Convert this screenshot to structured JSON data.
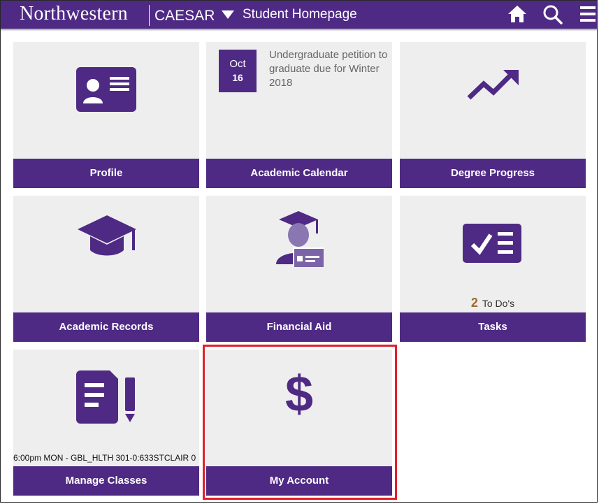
{
  "header": {
    "brand": "Northwestern",
    "app": "CAESAR",
    "page_title": "Student Homepage"
  },
  "icons": {
    "home": "home-icon",
    "search": "search-icon",
    "menu": "hamburger-menu-icon"
  },
  "colors": {
    "accent": "#4e2a84",
    "tile_bg": "#eeeeee",
    "highlight": "#e0202a",
    "todo_count": "#9c6b2e"
  },
  "tiles": [
    {
      "label": "Profile",
      "icon": "id-card-icon"
    },
    {
      "label": "Academic Calendar",
      "calendar": {
        "month": "Oct",
        "day": "16",
        "event": "Undergraduate petition to graduate due for Winter 2018"
      }
    },
    {
      "label": "Degree Progress",
      "icon": "trend-up-arrow-icon"
    },
    {
      "label": "Academic Records",
      "icon": "graduation-cap-icon"
    },
    {
      "label": "Financial Aid",
      "icon": "graduate-with-card-icon"
    },
    {
      "label": "Tasks",
      "icon": "checklist-icon",
      "todo_count": "2",
      "todo_label": "To Do's"
    },
    {
      "label": "Manage Classes",
      "icon": "document-pencil-icon",
      "class_line": "6:00pm MON - GBL_HLTH  301-0:633STCLAIR 0"
    },
    {
      "label": "My Account",
      "icon": "dollar-sign-icon",
      "highlighted": true
    }
  ]
}
